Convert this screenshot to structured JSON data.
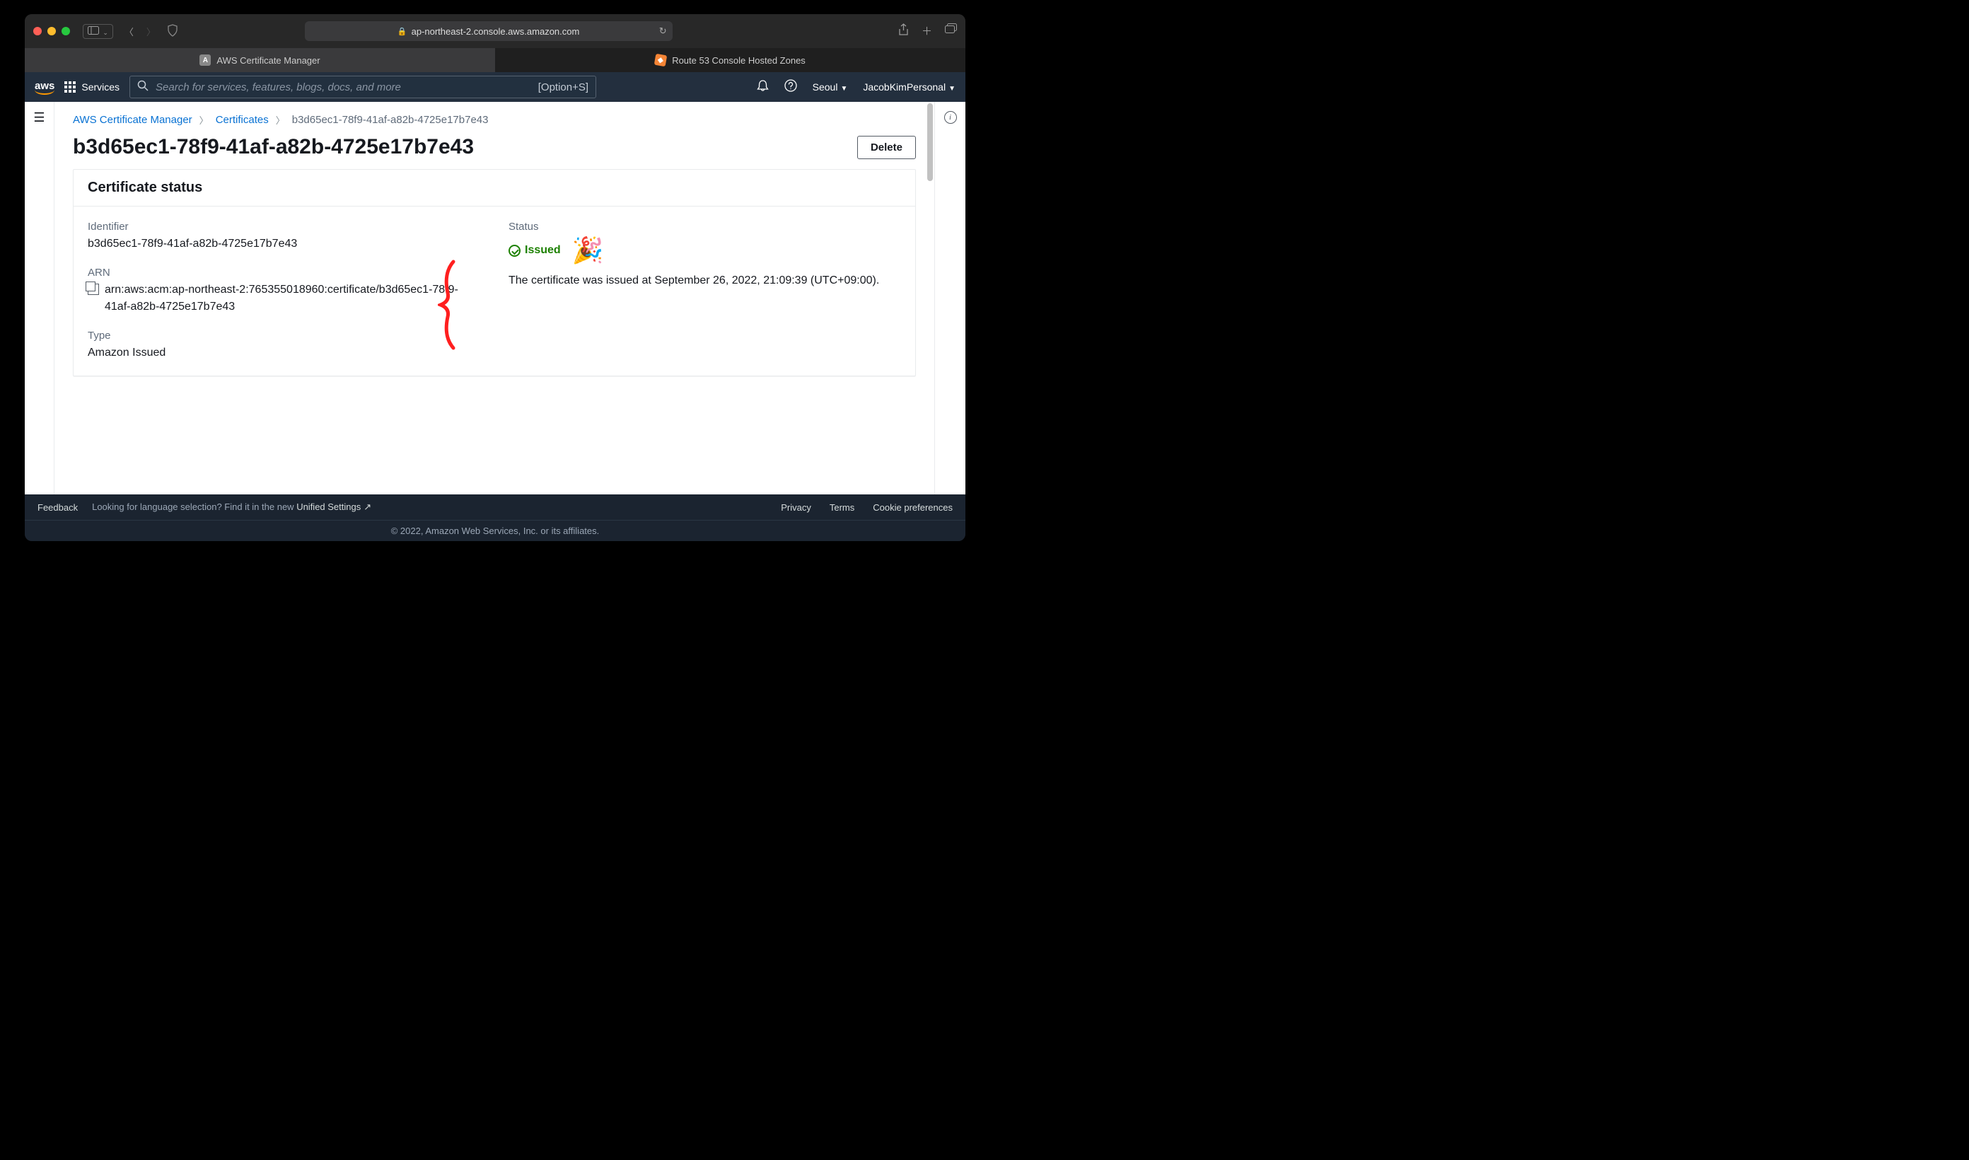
{
  "browser": {
    "url_host": "ap-northeast-2.console.aws.amazon.com",
    "tabs": [
      {
        "label": "AWS Certificate Manager",
        "active": true,
        "favicon": "A"
      },
      {
        "label": "Route 53 Console Hosted Zones",
        "active": false,
        "favicon": "◆"
      }
    ]
  },
  "aws_nav": {
    "logo": "aws",
    "services_label": "Services",
    "search_placeholder": "Search for services, features, blogs, docs, and more",
    "shortcut": "[Option+S]",
    "region": "Seoul",
    "account": "JacobKimPersonal"
  },
  "breadcrumb": {
    "root": "AWS Certificate Manager",
    "section": "Certificates",
    "current": "b3d65ec1-78f9-41af-a82b-4725e17b7e43"
  },
  "page": {
    "title": "b3d65ec1-78f9-41af-a82b-4725e17b7e43",
    "delete_label": "Delete"
  },
  "panel": {
    "header": "Certificate status",
    "identifier_label": "Identifier",
    "identifier_value": "b3d65ec1-78f9-41af-a82b-4725e17b7e43",
    "arn_label": "ARN",
    "arn_value": "arn:aws:acm:ap-northeast-2:765355018960:certificate/b3d65ec1-78f9-41af-a82b-4725e17b7e43",
    "type_label": "Type",
    "type_value": "Amazon Issued",
    "status_label": "Status",
    "status_value": "Issued",
    "status_desc": "The certificate was issued at September 26, 2022, 21:09:39 (UTC+09:00).",
    "party_emoji": "🎉"
  },
  "footer": {
    "feedback": "Feedback",
    "lang_prompt": "Looking for language selection? Find it in the new ",
    "unified": "Unified Settings",
    "privacy": "Privacy",
    "terms": "Terms",
    "cookies": "Cookie preferences",
    "copyright": "© 2022, Amazon Web Services, Inc. or its affiliates."
  }
}
